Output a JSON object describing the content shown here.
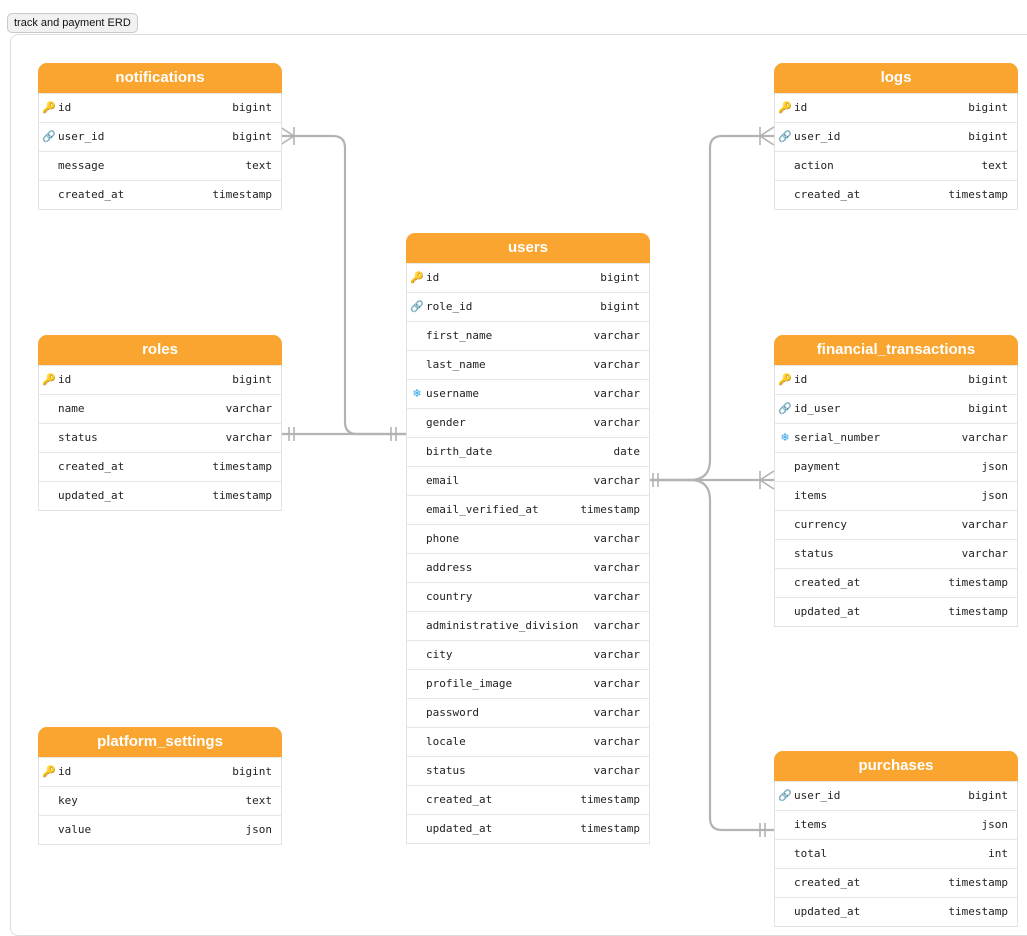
{
  "diagram_title": "track and payment ERD",
  "tables": {
    "notifications": {
      "name": "notifications",
      "columns": [
        {
          "name": "id",
          "type": "bigint",
          "icon": "key-icon"
        },
        {
          "name": "user_id",
          "type": "bigint",
          "icon": "link-icon"
        },
        {
          "name": "message",
          "type": "text",
          "icon": ""
        },
        {
          "name": "created_at",
          "type": "timestamp",
          "icon": ""
        }
      ]
    },
    "logs": {
      "name": "logs",
      "columns": [
        {
          "name": "id",
          "type": "bigint",
          "icon": "key-icon"
        },
        {
          "name": "user_id",
          "type": "bigint",
          "icon": "link-icon"
        },
        {
          "name": "action",
          "type": "text",
          "icon": ""
        },
        {
          "name": "created_at",
          "type": "timestamp",
          "icon": ""
        }
      ]
    },
    "users": {
      "name": "users",
      "columns": [
        {
          "name": "id",
          "type": "bigint",
          "icon": "key-icon"
        },
        {
          "name": "role_id",
          "type": "bigint",
          "icon": "link-icon"
        },
        {
          "name": "first_name",
          "type": "varchar",
          "icon": ""
        },
        {
          "name": "last_name",
          "type": "varchar",
          "icon": ""
        },
        {
          "name": "username",
          "type": "varchar",
          "icon": "unique-icon"
        },
        {
          "name": "gender",
          "type": "varchar",
          "icon": ""
        },
        {
          "name": "birth_date",
          "type": "date",
          "icon": ""
        },
        {
          "name": "email",
          "type": "varchar",
          "icon": ""
        },
        {
          "name": "email_verified_at",
          "type": "timestamp",
          "icon": ""
        },
        {
          "name": "phone",
          "type": "varchar",
          "icon": ""
        },
        {
          "name": "address",
          "type": "varchar",
          "icon": ""
        },
        {
          "name": "country",
          "type": "varchar",
          "icon": ""
        },
        {
          "name": "administrative_division",
          "type": "varchar",
          "icon": ""
        },
        {
          "name": "city",
          "type": "varchar",
          "icon": ""
        },
        {
          "name": "profile_image",
          "type": "varchar",
          "icon": ""
        },
        {
          "name": "password",
          "type": "varchar",
          "icon": ""
        },
        {
          "name": "locale",
          "type": "varchar",
          "icon": ""
        },
        {
          "name": "status",
          "type": "varchar",
          "icon": ""
        },
        {
          "name": "created_at",
          "type": "timestamp",
          "icon": ""
        },
        {
          "name": "updated_at",
          "type": "timestamp",
          "icon": ""
        }
      ]
    },
    "roles": {
      "name": "roles",
      "columns": [
        {
          "name": "id",
          "type": "bigint",
          "icon": "key-icon"
        },
        {
          "name": "name",
          "type": "varchar",
          "icon": ""
        },
        {
          "name": "status",
          "type": "varchar",
          "icon": ""
        },
        {
          "name": "created_at",
          "type": "timestamp",
          "icon": ""
        },
        {
          "name": "updated_at",
          "type": "timestamp",
          "icon": ""
        }
      ]
    },
    "financial_transactions": {
      "name": "financial_transactions",
      "columns": [
        {
          "name": "id",
          "type": "bigint",
          "icon": "key-icon"
        },
        {
          "name": "id_user",
          "type": "bigint",
          "icon": "link-icon"
        },
        {
          "name": "serial_number",
          "type": "varchar",
          "icon": "unique-icon"
        },
        {
          "name": "payment",
          "type": "json",
          "icon": ""
        },
        {
          "name": "items",
          "type": "json",
          "icon": ""
        },
        {
          "name": "currency",
          "type": "varchar",
          "icon": ""
        },
        {
          "name": "status",
          "type": "varchar",
          "icon": ""
        },
        {
          "name": "created_at",
          "type": "timestamp",
          "icon": ""
        },
        {
          "name": "updated_at",
          "type": "timestamp",
          "icon": ""
        }
      ]
    },
    "platform_settings": {
      "name": "platform_settings",
      "columns": [
        {
          "name": "id",
          "type": "bigint",
          "icon": "key-icon"
        },
        {
          "name": "key",
          "type": "text",
          "icon": ""
        },
        {
          "name": "value",
          "type": "json",
          "icon": ""
        }
      ]
    },
    "purchases": {
      "name": "purchases",
      "columns": [
        {
          "name": "user_id",
          "type": "bigint",
          "icon": "link-icon"
        },
        {
          "name": "items",
          "type": "json",
          "icon": ""
        },
        {
          "name": "total",
          "type": "int",
          "icon": ""
        },
        {
          "name": "created_at",
          "type": "timestamp",
          "icon": ""
        },
        {
          "name": "updated_at",
          "type": "timestamp",
          "icon": ""
        }
      ]
    }
  },
  "colors": {
    "header": "#f9a52f",
    "key_icon": "#e9b400",
    "link_icon": "#9a4fd8",
    "unique_icon": "#2aa3e6",
    "connector": "#b3b3b3"
  }
}
